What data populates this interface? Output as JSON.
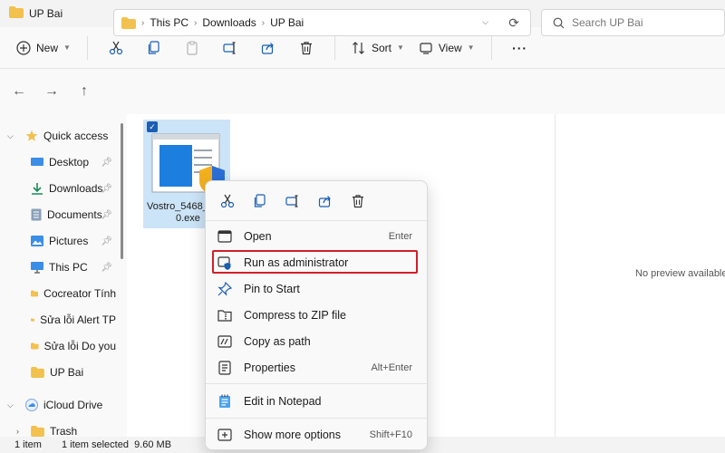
{
  "window": {
    "title": "UP Bai"
  },
  "toolbar": {
    "new_label": "New",
    "sort_label": "Sort",
    "view_label": "View",
    "more_label": "···"
  },
  "address": {
    "crumbs": [
      "This PC",
      "Downloads",
      "UP Bai"
    ]
  },
  "search": {
    "placeholder": "Search UP Bai"
  },
  "sidebar": {
    "quick_access": "Quick access",
    "items": [
      {
        "label": "Desktop",
        "pinned": true
      },
      {
        "label": "Downloads",
        "pinned": true
      },
      {
        "label": "Documents",
        "pinned": true
      },
      {
        "label": "Pictures",
        "pinned": true
      },
      {
        "label": "This PC",
        "pinned": true
      },
      {
        "label": "Cocreator Tính",
        "pinned": false
      },
      {
        "label": "Sửa lỗi Alert TP",
        "pinned": false
      },
      {
        "label": "Sửa lỗi Do you",
        "pinned": false
      },
      {
        "label": "UP Bai",
        "pinned": false
      }
    ],
    "icloud": "iCloud Drive",
    "trash": "Trash"
  },
  "file": {
    "name_line1": "Vostro_5468_",
    "name_line2": "0.exe"
  },
  "preview": {
    "text": "No preview available"
  },
  "status": {
    "count": "1 item",
    "selected": "1 item selected",
    "size": "9.60 MB"
  },
  "context_menu": {
    "items": [
      {
        "label": "Open",
        "shortcut": "Enter"
      },
      {
        "label": "Run as administrator",
        "shortcut": ""
      },
      {
        "label": "Pin to Start",
        "shortcut": ""
      },
      {
        "label": "Compress to ZIP file",
        "shortcut": ""
      },
      {
        "label": "Copy as path",
        "shortcut": ""
      },
      {
        "label": "Properties",
        "shortcut": "Alt+Enter"
      },
      {
        "label": "Edit in Notepad",
        "shortcut": ""
      },
      {
        "label": "Show more options",
        "shortcut": "Shift+F10"
      }
    ]
  },
  "colors": {
    "accent": "#1a5fb4",
    "selection": "#cce4f7",
    "highlight_box": "#d0202a",
    "folder": "#f2c14e"
  }
}
